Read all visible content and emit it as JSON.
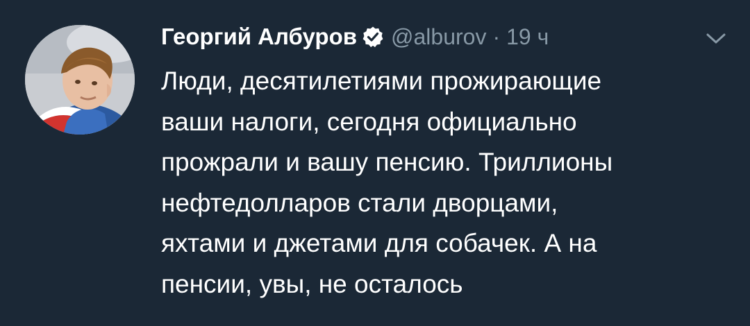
{
  "top_fragment": "",
  "tweet": {
    "author": {
      "display_name": "Георгий Албуров",
      "handle": "@alburov",
      "verified": true,
      "avatar_icon": "profile-photo"
    },
    "separator": "·",
    "timestamp": "19 ч",
    "text": "Люди, десятилетиями прожирающие\nваши налоги, сегодня официально\nпрожрали и вашу пенсию. Триллионы\nнефтедолларов стали дворцами,\nяхтами и джетами для собачек. А на\nпенсии, увы, не осталось",
    "menu_icon": "chevron-down-icon"
  },
  "colors": {
    "background": "#1b2836",
    "text": "#ffffff",
    "secondary": "#8899a6",
    "verified_badge": "#ffffff"
  }
}
